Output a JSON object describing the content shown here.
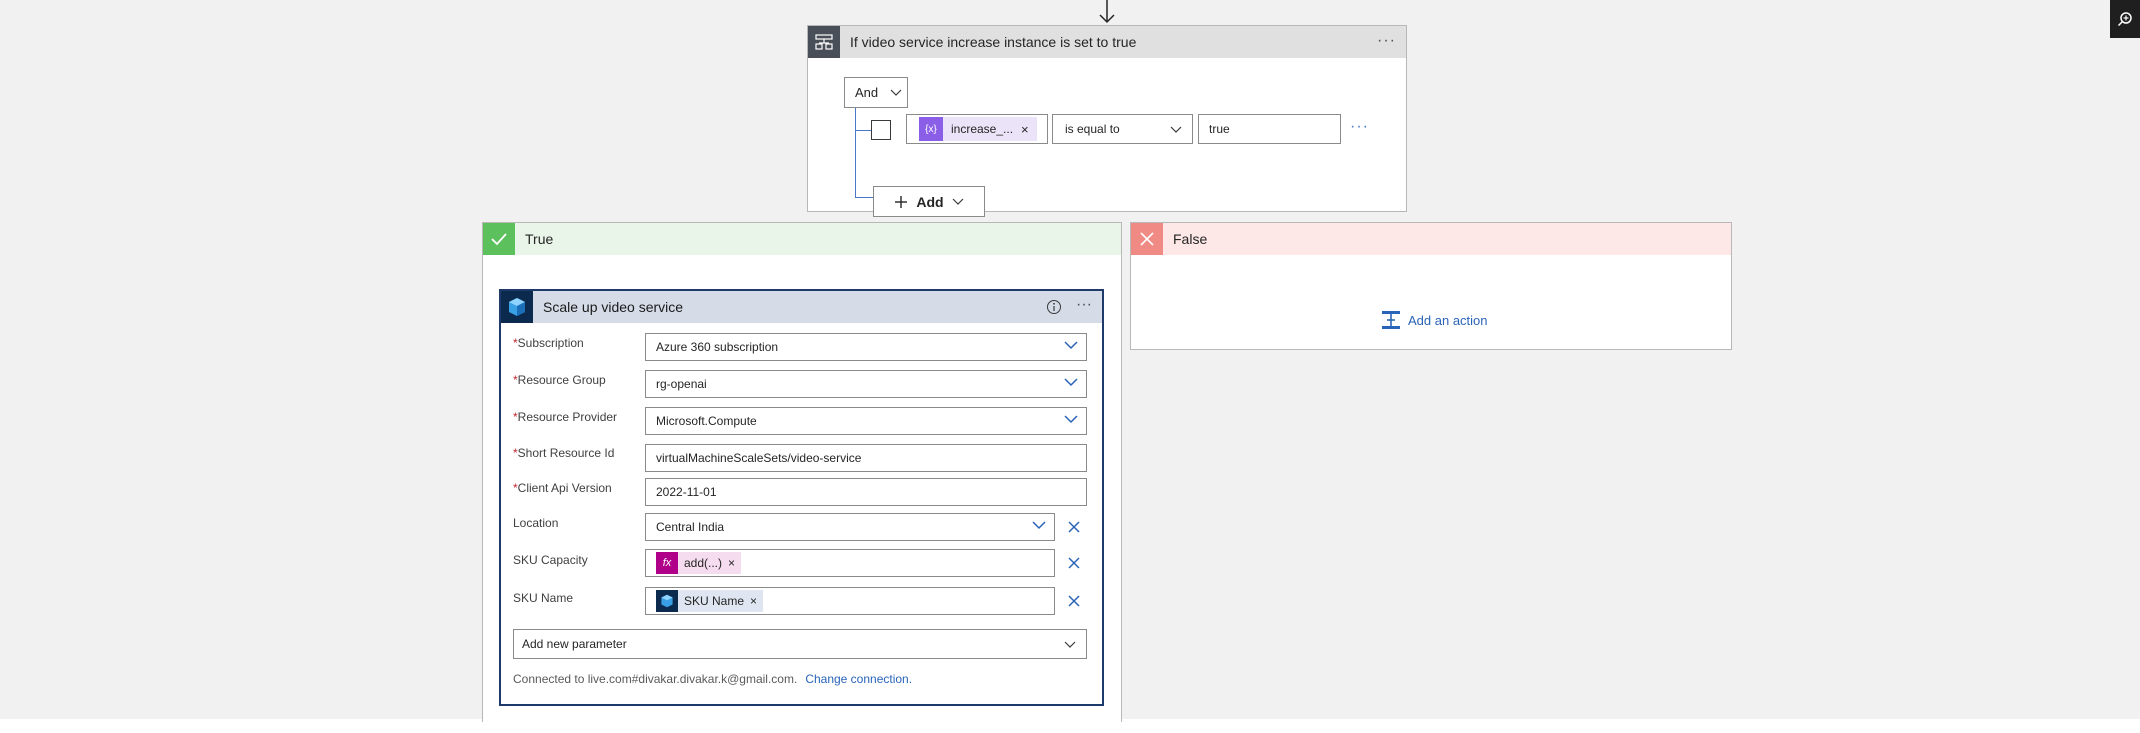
{
  "condition": {
    "title": "If video service increase instance is set to true",
    "group_operator": "And",
    "row": {
      "token_label": "increase_...",
      "operator": "is equal to",
      "value": "true"
    },
    "add_label": "Add"
  },
  "true_branch": {
    "title": "True",
    "action": {
      "title": "Scale up video service",
      "params": [
        {
          "label": "Subscription",
          "required": true,
          "value": "Azure 360 subscription"
        },
        {
          "label": "Resource Group",
          "required": true,
          "value": "rg-openai"
        },
        {
          "label": "Resource Provider",
          "required": true,
          "value": "Microsoft.Compute"
        },
        {
          "label": "Short Resource Id",
          "required": true,
          "value": "virtualMachineScaleSets/video-service"
        },
        {
          "label": "Client Api Version",
          "required": true,
          "value": "2022-11-01"
        },
        {
          "label": "Location",
          "required": false,
          "value": "Central India"
        },
        {
          "label": "SKU Capacity",
          "required": false,
          "token": "add(...)"
        },
        {
          "label": "SKU Name",
          "required": false,
          "token": "SKU Name"
        }
      ],
      "add_param_label": "Add new parameter",
      "connected_text": "Connected to live.com#divakar.divakar.k@gmail.com.",
      "change_connection": "Change connection."
    }
  },
  "false_branch": {
    "title": "False",
    "add_action_label": "Add an action"
  },
  "colors": {
    "true_green": "#5cc05c",
    "false_red": "#f08a84",
    "link_blue": "#2a64b8",
    "required_red": "#c4262e",
    "fx_magenta": "#b0008a",
    "var_purple": "#8a5ee6"
  }
}
